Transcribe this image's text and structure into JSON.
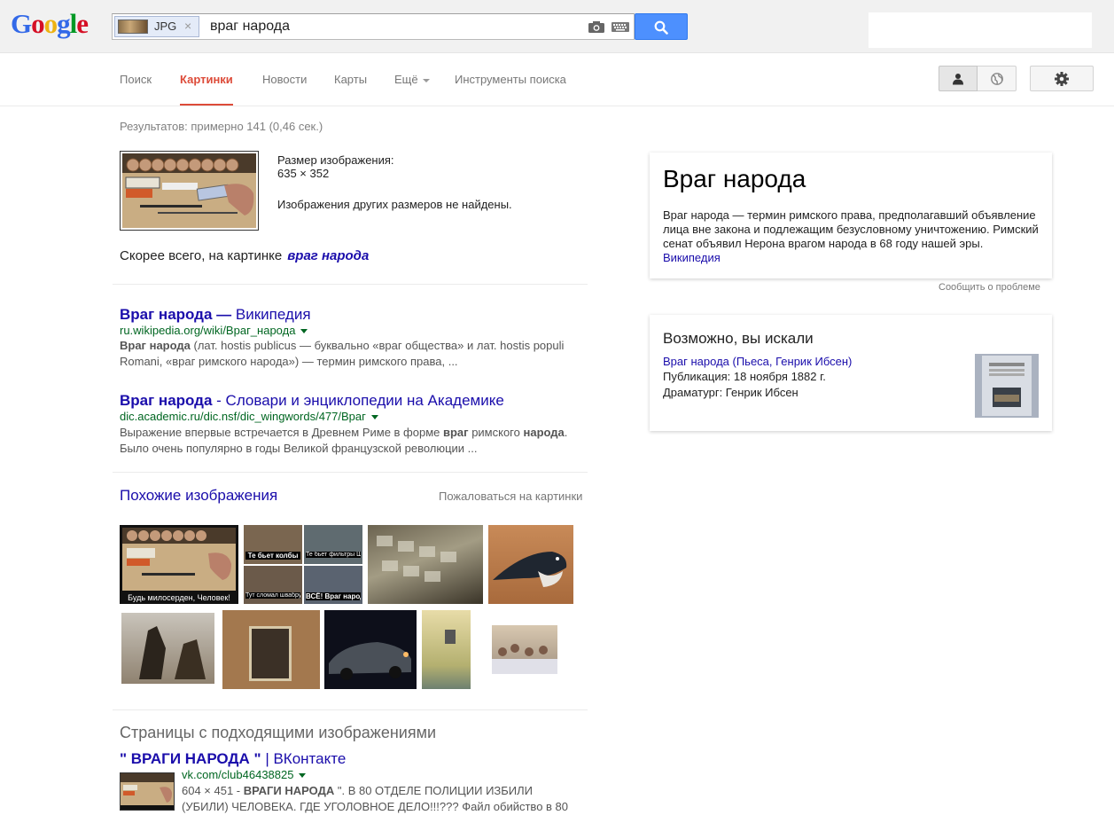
{
  "header": {
    "logo_letters": [
      "G",
      "o",
      "o",
      "g",
      "l",
      "e"
    ],
    "logo_colors": [
      "#3369e8",
      "#d50f25",
      "#eeb211",
      "#3369e8",
      "#009925",
      "#d50f25"
    ],
    "chip_ext": "JPG",
    "chip_remove": "×",
    "query": "враг народа"
  },
  "nav": {
    "items": [
      "Поиск",
      "Картинки",
      "Новости",
      "Карты",
      "Ещё",
      "Инструменты поиска"
    ],
    "active": "Картинки"
  },
  "stats": "Результатов: примерно 141 (0,46 сек.)",
  "query_image": {
    "size_label": "Размер изображения:",
    "size_value": "635 × 352",
    "no_sizes": "Изображения других размеров не найдены."
  },
  "best_guess": {
    "label": "Скорее всего, на картинке",
    "term": "враг народа"
  },
  "results": [
    {
      "title_bold": "Враг народа —",
      "title_rest": " Википедия",
      "url": "ru.wikipedia.org/wiki/Враг_народа",
      "snippet_parts": [
        "Враг народа",
        " (лат. hostis publicus — буквально «враг общества» и лат. hostis populi Romani, «враг римского народа») — термин римского права, ..."
      ]
    },
    {
      "title_bold": "Враг народа",
      "title_rest": " - Словари и энциклопедии на Академике",
      "url": "dic.academic.ru/dic.nsf/dic_wingwords/477/Враг",
      "snippet_parts": [
        "Выражение впервые встречается в Древнем Риме в форме ",
        "враг",
        " римского ",
        "народа",
        ". Было очень популярно в годы Великой французской революции ..."
      ]
    }
  ],
  "similar": {
    "heading": "Похожие изображения",
    "report": "Пожаловаться на картинки",
    "captions": {
      "img1": "Будь милосерден, Человек!",
      "img2_a": "Те бьет колбы",
      "img2_b": "Те бьет фильтры Шатт",
      "img2_c": "Тут сломал швабру!",
      "img2_d": "ВСЁ! Враг народа"
    }
  },
  "pages": {
    "heading": "Страницы с подходящими изображениями",
    "vk_title_bold": "\" ВРАГИ НАРОДА \"",
    "vk_title_rest": " | ВКонтакте",
    "vk_url": "vk.com/club46438825",
    "vk_snip_dims": "604 × 451 - ",
    "vk_snip_bold": "ВРАГИ НАРОДА",
    "vk_snip_rest": " \". В 80 ОТДЕЛЕ ПОЛИЦИИ ИЗБИЛИ (УБИЛИ) ЧЕЛОВЕКА. ГДЕ УГОЛОВНОЕ ДЕЛО!!!??? Файл обийство в 80"
  },
  "knowledge_panel": {
    "title": "Враг народа",
    "description": "Враг народа — термин римского права, предполагавший объявление лица вне закона и подлежащим безусловному уничтожению. Римский сенат объявил Нерона врагом народа в 68 году нашей эры.",
    "source": "Википедия",
    "report": "Сообщить о проблеме"
  },
  "did_you_mean": {
    "heading": "Возможно, вы искали",
    "link": "Враг народа (Пьеса, Генрик Ибсен)",
    "pub_label": "Публикация:",
    "pub_value": " 18 ноября 1882 г.",
    "author_label": "Драматург:",
    "author_value": " Генрик Ибсен"
  }
}
